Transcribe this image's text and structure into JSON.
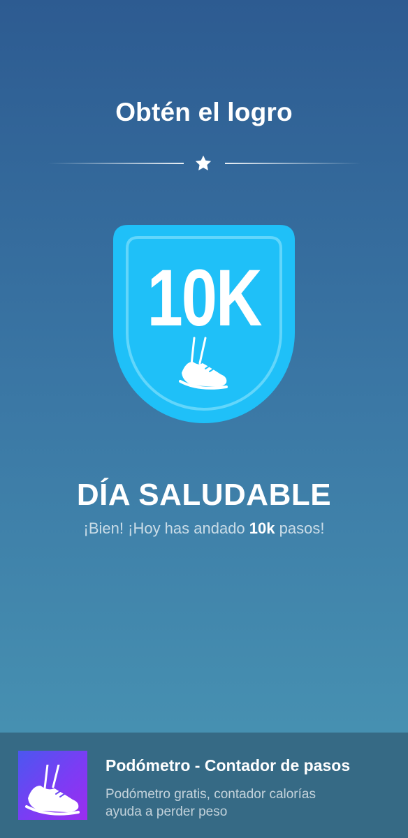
{
  "header": {
    "title": "Obtén el logro"
  },
  "badge": {
    "label": "10K",
    "icon": "shoe-icon",
    "color": "#1fc0f8"
  },
  "achievement": {
    "title": "DÍA SALUDABLE",
    "desc_prefix": "¡Bien! ¡Hoy has andado ",
    "desc_bold": "10k",
    "desc_suffix": " pasos!"
  },
  "ad": {
    "title": "Podómetro - Contador de pasos",
    "desc_line1": "Podómetro gratis, contador calorías",
    "desc_line2": "ayuda a perder peso",
    "icon": "shoe-icon"
  }
}
